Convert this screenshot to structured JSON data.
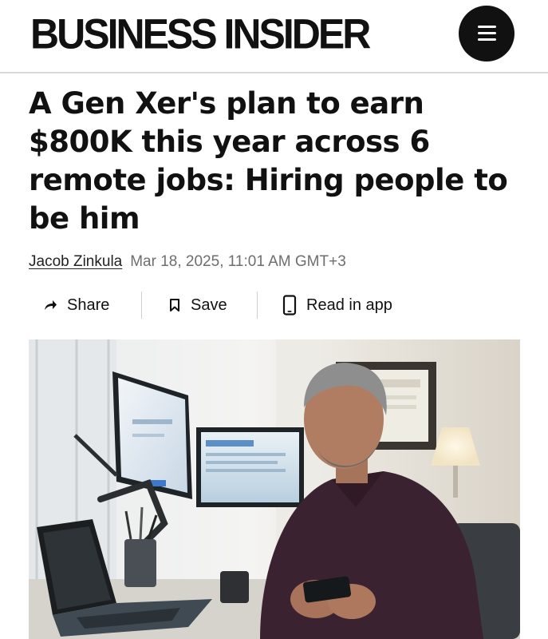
{
  "header": {
    "brand": "BUSINESS INSIDER",
    "menu_icon": "hamburger-menu-icon"
  },
  "article": {
    "headline": "A Gen Xer's plan to earn $800K this year across 6 remote jobs: Hiring people to be him",
    "author": "Jacob Zinkula",
    "date": "Mar 18, 2025, 11:01 AM GMT+3"
  },
  "actions": {
    "share": {
      "label": "Share",
      "icon": "share-arrow-icon"
    },
    "save": {
      "label": "Save",
      "icon": "bookmark-icon"
    },
    "read_in_app": {
      "label": "Read in app",
      "icon": "phone-icon"
    }
  },
  "colors": {
    "text": "#111111",
    "meta": "#6e6e6e",
    "divider": "#d9d9d9"
  }
}
